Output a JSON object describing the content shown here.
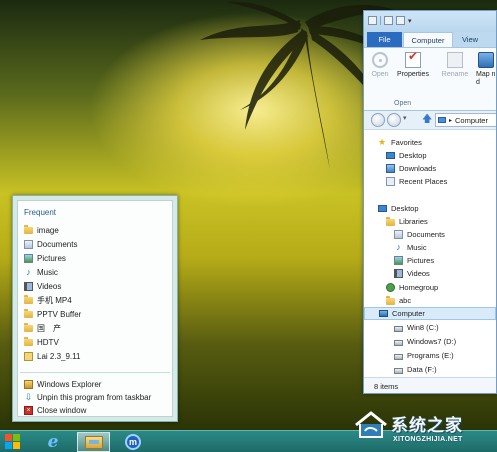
{
  "jumplist": {
    "heading": "Frequent",
    "items": [
      {
        "label": "image",
        "icon": "folder-icon"
      },
      {
        "label": "Documents",
        "icon": "documents-library-icon"
      },
      {
        "label": "Pictures",
        "icon": "pictures-library-icon"
      },
      {
        "label": "Music",
        "icon": "music-library-icon"
      },
      {
        "label": "Videos",
        "icon": "videos-library-icon"
      },
      {
        "label": "手机 MP4",
        "icon": "folder-icon"
      },
      {
        "label": "PPTV Buffer",
        "icon": "folder-icon"
      },
      {
        "label": "国　产",
        "icon": "folder-icon"
      },
      {
        "label": "HDTV",
        "icon": "folder-icon"
      },
      {
        "label": "Lai 2.3_9.11",
        "icon": "file-icon"
      }
    ],
    "tasks": [
      {
        "label": "Windows Explorer",
        "icon": "explorer-icon"
      },
      {
        "label": "Unpin this program from taskbar",
        "icon": "unpin-icon"
      },
      {
        "label": "Close window",
        "icon": "close-window-icon"
      }
    ]
  },
  "explorer": {
    "tabs": {
      "file": "File",
      "computer": "Computer",
      "view": "View"
    },
    "ribbon": {
      "open": "Open",
      "properties": "Properties",
      "rename": "Rename",
      "map": "Map n",
      "map2": "d",
      "group_label": "Open"
    },
    "address": {
      "path": "Computer"
    },
    "nav": {
      "favorites": "Favorites",
      "desktop_fav": "Desktop",
      "downloads": "Downloads",
      "recent": "Recent Places",
      "desktop": "Desktop",
      "libraries": "Libraries",
      "documents": "Documents",
      "music": "Music",
      "pictures": "Pictures",
      "videos": "Videos",
      "homegroup": "Homegroup",
      "abc": "abc",
      "computer": "Computer",
      "win8": "Win8 (C:)",
      "windows7": "Windows7 (D:)",
      "programs": "Programs (E:)",
      "data": "Data (F:)"
    },
    "status": "8 items"
  },
  "taskbar": {
    "maxthon_letter": "m",
    "colors": {
      "accent": "#1e6b69",
      "highlight": "#64b3ad"
    }
  },
  "watermark": {
    "title": "系统之家",
    "url": "XITONGZHIJIA.NET"
  }
}
